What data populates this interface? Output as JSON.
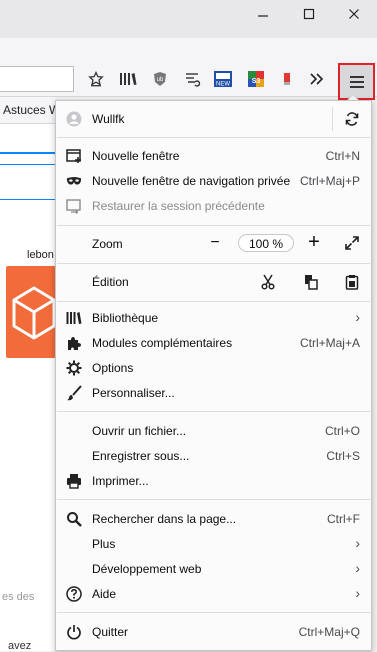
{
  "window": {
    "minimize_icon": "minimize-icon",
    "maximize_icon": "maximize-icon",
    "close_icon": "close-icon"
  },
  "toolbar": {
    "icons": [
      "bookmark-star-icon",
      "library-icon",
      "ublock-icon",
      "history-icon",
      "new-extension-icon",
      "s3-extension-icon",
      "red-extension-icon",
      "overflow-icon"
    ],
    "menu_icon": "hamburger-menu-icon",
    "accent": "#e2212a"
  },
  "bookmarks": {
    "partial_text": "Astuces W"
  },
  "background_page": {
    "tile_label": "lebon",
    "footer_text_1": "es  des",
    "footer_text_2": "avez"
  },
  "menu": {
    "account": {
      "name": "Wullfk"
    },
    "new_window": {
      "label": "Nouvelle fenêtre",
      "shortcut": "Ctrl+N"
    },
    "private_window": {
      "label": "Nouvelle fenêtre de navigation privée",
      "shortcut": "Ctrl+Maj+P"
    },
    "restore_session": {
      "label": "Restaurer la session précédente"
    },
    "zoom": {
      "label": "Zoom",
      "minus": "−",
      "value": "100 %",
      "plus": "+"
    },
    "edit": {
      "label": "Édition"
    },
    "library": {
      "label": "Bibliothèque"
    },
    "addons": {
      "label": "Modules complémentaires",
      "shortcut": "Ctrl+Maj+A"
    },
    "options": {
      "label": "Options"
    },
    "customize": {
      "label": "Personnaliser..."
    },
    "open_file": {
      "label": "Ouvrir un fichier...",
      "shortcut": "Ctrl+O"
    },
    "save_as": {
      "label": "Enregistrer sous...",
      "shortcut": "Ctrl+S"
    },
    "print": {
      "label": "Imprimer..."
    },
    "find": {
      "label": "Rechercher dans la page...",
      "shortcut": "Ctrl+F"
    },
    "more": {
      "label": "Plus"
    },
    "web_dev": {
      "label": "Développement web"
    },
    "help": {
      "label": "Aide"
    },
    "quit": {
      "label": "Quitter",
      "shortcut": "Ctrl+Maj+Q"
    }
  }
}
